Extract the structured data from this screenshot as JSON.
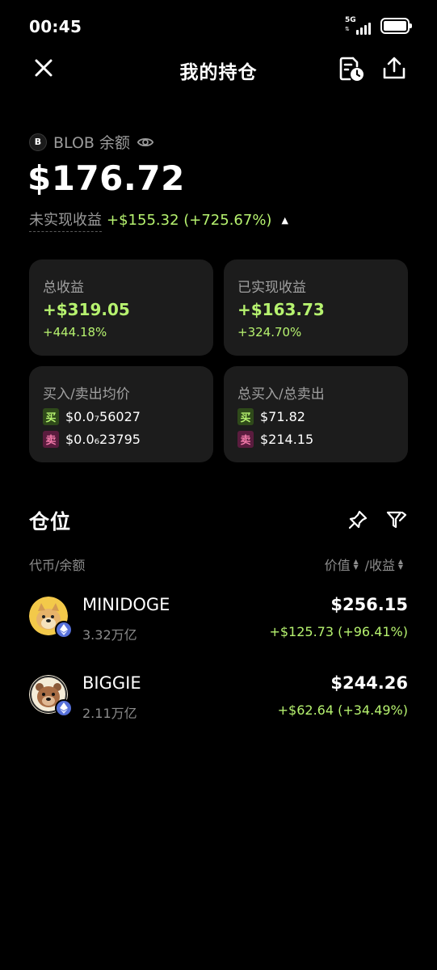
{
  "status": {
    "time": "00:45",
    "network": "5G"
  },
  "header": {
    "title": "我的持仓"
  },
  "balance": {
    "token_letter": "B",
    "label": "BLOB 余额",
    "value": "$176.72",
    "unrealized_label": "未实现收益",
    "unrealized_value": "+$155.32 (+725.67%)"
  },
  "cards": {
    "total": {
      "title": "总收益",
      "main": "+$319.05",
      "sub": "+444.18%"
    },
    "realized": {
      "title": "已实现收益",
      "main": "+$163.73",
      "sub": "+324.70%"
    },
    "avg": {
      "title": "买入/卖出均价",
      "buy_tag": "买",
      "buy": "$0.0₇56027",
      "sell_tag": "卖",
      "sell": "$0.0₆23795"
    },
    "totals": {
      "title": "总买入/总卖出",
      "buy_tag": "买",
      "buy": "$71.82",
      "sell_tag": "卖",
      "sell": "$214.15"
    }
  },
  "positions": {
    "title": "仓位",
    "col_left": "代币/余额",
    "col_value": "价值",
    "col_pnl": "/收益",
    "items": [
      {
        "name": "MINIDOGE",
        "amount": "3.32万亿",
        "value": "$256.15",
        "pnl": "+$125.73 (+96.41%)"
      },
      {
        "name": "BIGGIE",
        "amount": "2.11万亿",
        "value": "$244.26",
        "pnl": "+$62.64 (+34.49%)"
      }
    ]
  },
  "colors": {
    "positive": "#b6f26f",
    "card_bg": "#1c1c1c",
    "sell_tag": "#f27aa9"
  },
  "icons": [
    "close-icon",
    "history-icon",
    "share-icon",
    "eye-icon",
    "pin-icon",
    "filter-icon",
    "ethereum-icon"
  ]
}
